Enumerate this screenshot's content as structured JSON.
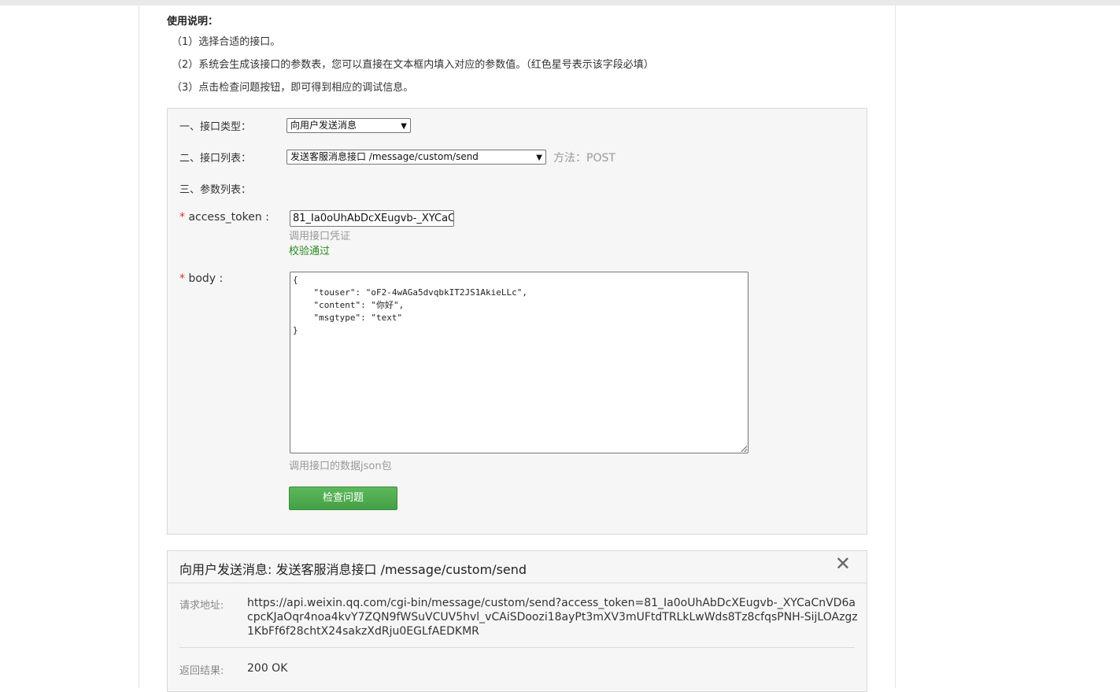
{
  "usage": {
    "title": "使用说明：",
    "lines": [
      "（1）选择合适的接口。",
      "（2）系统会生成该接口的参数表，您可以直接在文本框内填入对应的参数值。（红色星号表示该字段必填）",
      "（3）点击检查问题按钮，即可得到相应的调试信息。"
    ]
  },
  "form": {
    "type_label": "一、接口类型：",
    "type_value": "向用户发送消息",
    "list_label": "二、接口列表：",
    "list_value": "发送客服消息接口 /message/custom/send",
    "method": "方法：POST",
    "params_label": "三、参数列表：",
    "required_mark": "*",
    "access_token": {
      "label": " access_token :",
      "value": "81_Ia0oUhAbDcXEugvb-_XYCaC",
      "hint": "调用接口凭证",
      "status": "校验通过"
    },
    "body": {
      "label": " body :",
      "value": "{\n    \"touser\": \"oF2-4wAGa5dvqbkIT2JS1AkieLLc\",\n    \"content\": \"你好\",\n    \"msgtype\": \"text\"\n}",
      "hint": "调用接口的数据json包"
    },
    "submit": "检查问题"
  },
  "result": {
    "title": "向用户发送消息: 发送客服消息接口 /message/custom/send",
    "close": "✕",
    "url_label": "请求地址:",
    "url": "https://api.weixin.qq.com/cgi-bin/message/custom/send?access_token=81_Ia0oUhAbDcXEugvb-_XYCaCnVD6acpcKJaOqr4noa4kvY7ZQN9fWSuVCUV5hvl_vCAiSDoozi18ayPt3mXV3mUFtdTRLkLwWds8Tz8cfqsPNH-SijLOAzgz1KbFf6f28chtX24sakzXdRju0EGLfAEDKMR",
    "response_label": "返回结果:",
    "response": "200 OK"
  }
}
